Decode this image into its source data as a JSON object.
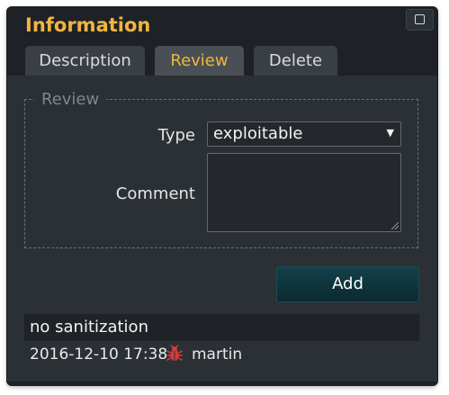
{
  "panel": {
    "title": "Information",
    "icons": {
      "window_button": "maximize-icon",
      "severity": "bug-icon"
    }
  },
  "tabs": [
    {
      "label": "Description",
      "active": false
    },
    {
      "label": "Review",
      "active": true
    },
    {
      "label": "Delete",
      "active": false
    }
  ],
  "review_form": {
    "legend": "Review",
    "type_label": "Type",
    "type_selected": "exploitable",
    "comment_label": "Comment",
    "comment_value": "",
    "add_label": "Add"
  },
  "existing_review": {
    "comment": "no sanitization",
    "timestamp": "2016-12-10 17:38",
    "user": "martin"
  },
  "colors": {
    "accent": "#f0b540",
    "background": "#2b3035",
    "header": "#1e2226",
    "button": "#0f3840",
    "bug": "#d93a3a"
  }
}
